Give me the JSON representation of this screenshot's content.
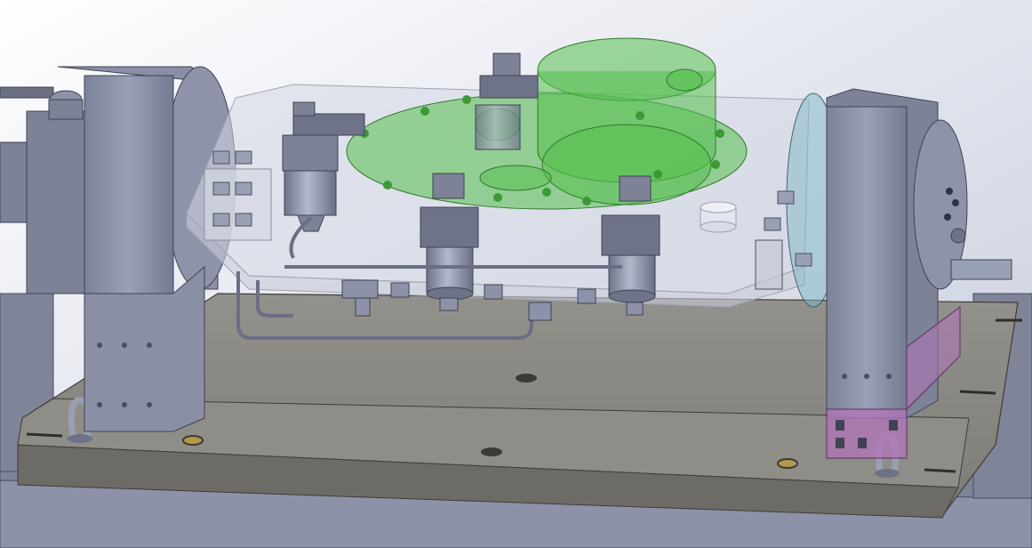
{
  "scene": {
    "description_hidden": "",
    "colors": {
      "background_top": "#ffffff",
      "background_bottom": "#c9cfe0",
      "steel": "#8a90a8",
      "steel_dark": "#5f6479",
      "steel_light": "#a7adc3",
      "base_plate": "#8c8a84",
      "base_plate_edge": "#6f6d68",
      "glass": "#d7dbe6",
      "green_part": "#4fb84a",
      "purple_part": "#b274b8",
      "brass": "#b39a4a"
    }
  }
}
